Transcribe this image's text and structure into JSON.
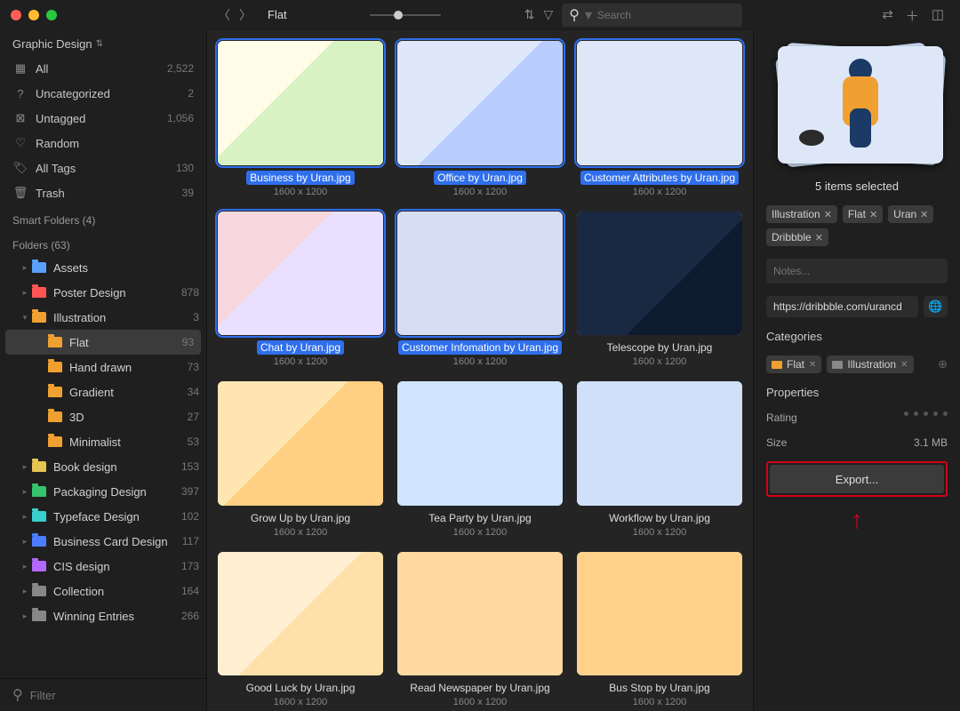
{
  "window": {
    "sidebar_title": "Graphic Design",
    "breadcrumb": "Flat"
  },
  "sidebar": {
    "library": [
      {
        "icon": "grid",
        "label": "All",
        "count": "2,522"
      },
      {
        "icon": "question",
        "label": "Uncategorized",
        "count": "2"
      },
      {
        "icon": "untag",
        "label": "Untagged",
        "count": "1,056"
      },
      {
        "icon": "bulb",
        "label": "Random",
        "count": ""
      },
      {
        "icon": "tag",
        "label": "All Tags",
        "count": "130"
      },
      {
        "icon": "trash",
        "label": "Trash",
        "count": "39"
      }
    ],
    "smart_label": "Smart Folders (4)",
    "folders_label": "Folders (63)",
    "folders": [
      {
        "level": 1,
        "chev": "▸",
        "color": "#5aa0ff",
        "label": "Assets",
        "count": ""
      },
      {
        "level": 1,
        "chev": "▸",
        "color": "#ff5555",
        "label": "Poster Design",
        "count": "878"
      },
      {
        "level": 1,
        "chev": "▾",
        "color": "#f0a030",
        "label": "Illustration",
        "count": "3"
      },
      {
        "level": 2,
        "chev": "",
        "color": "#f0a030",
        "label": "Flat",
        "count": "93",
        "active": true
      },
      {
        "level": 2,
        "chev": "",
        "color": "#f0a030",
        "label": "Hand drawn",
        "count": "73"
      },
      {
        "level": 2,
        "chev": "",
        "color": "#f0a030",
        "label": "Gradient",
        "count": "34"
      },
      {
        "level": 2,
        "chev": "",
        "color": "#f0a030",
        "label": "3D",
        "count": "27"
      },
      {
        "level": 2,
        "chev": "",
        "color": "#f0a030",
        "label": "Minimalist",
        "count": "53"
      },
      {
        "level": 1,
        "chev": "▸",
        "color": "#e6c452",
        "label": "Book design",
        "count": "153"
      },
      {
        "level": 1,
        "chev": "▸",
        "color": "#35c46b",
        "label": "Packaging Design",
        "count": "397"
      },
      {
        "level": 1,
        "chev": "▸",
        "color": "#38cfcf",
        "label": "Typeface Design",
        "count": "102"
      },
      {
        "level": 1,
        "chev": "▸",
        "color": "#4a7dff",
        "label": "Business Card Design",
        "count": "117"
      },
      {
        "level": 1,
        "chev": "▸",
        "color": "#b468ff",
        "label": "CIS design",
        "count": "173"
      },
      {
        "level": 1,
        "chev": "▸",
        "color": "#888888",
        "label": "Collection",
        "count": "164"
      },
      {
        "level": 1,
        "chev": "▸",
        "color": "#888888",
        "label": "Winning Entries",
        "count": "266"
      }
    ],
    "filter_placeholder": "Filter"
  },
  "toolbar": {
    "search_placeholder": "Search"
  },
  "grid": {
    "items": [
      {
        "name": "Business by Uran.jpg",
        "dim": "1600 x 1200",
        "selected": true,
        "art": "c1"
      },
      {
        "name": "Office by Uran.jpg",
        "dim": "1600 x 1200",
        "selected": true,
        "art": "c2"
      },
      {
        "name": "Customer Attributes by Uran.jpg",
        "dim": "1600 x 1200",
        "selected": true,
        "art": "c3"
      },
      {
        "name": "Chat by Uran.jpg",
        "dim": "1600 x 1200",
        "selected": true,
        "art": "c4"
      },
      {
        "name": "Customer Infomation by Uran.jpg",
        "dim": "1600 x 1200",
        "selected": true,
        "art": "c5"
      },
      {
        "name": "Telescope by Uran.jpg",
        "dim": "1600 x 1200",
        "selected": false,
        "art": "c6"
      },
      {
        "name": "Grow Up by Uran.jpg",
        "dim": "1600 x 1200",
        "selected": false,
        "art": "c7"
      },
      {
        "name": "Tea Party by Uran.jpg",
        "dim": "1600 x 1200",
        "selected": false,
        "art": "c8"
      },
      {
        "name": "Workflow by Uran.jpg",
        "dim": "1600 x 1200",
        "selected": false,
        "art": "c9"
      },
      {
        "name": "Good Luck by Uran.jpg",
        "dim": "1600 x 1200",
        "selected": false,
        "art": "c10"
      },
      {
        "name": "Read Newspaper by Uran.jpg",
        "dim": "1600 x 1200",
        "selected": false,
        "art": "c11"
      },
      {
        "name": "Bus Stop by Uran.jpg",
        "dim": "1600 x 1200",
        "selected": false,
        "art": "c12"
      }
    ]
  },
  "inspector": {
    "selection_text": "5 items selected",
    "tags": [
      "Illustration",
      "Flat",
      "Uran",
      "Dribbble"
    ],
    "notes_placeholder": "Notes...",
    "url": "https://dribbble.com/urancd",
    "categories_label": "Categories",
    "categories": [
      {
        "label": "Flat",
        "color": "#f0a030"
      },
      {
        "label": "Illustration",
        "color": "#888888"
      }
    ],
    "properties_label": "Properties",
    "rating_label": "Rating",
    "size_label": "Size",
    "size_value": "3.1 MB",
    "export_label": "Export..."
  }
}
